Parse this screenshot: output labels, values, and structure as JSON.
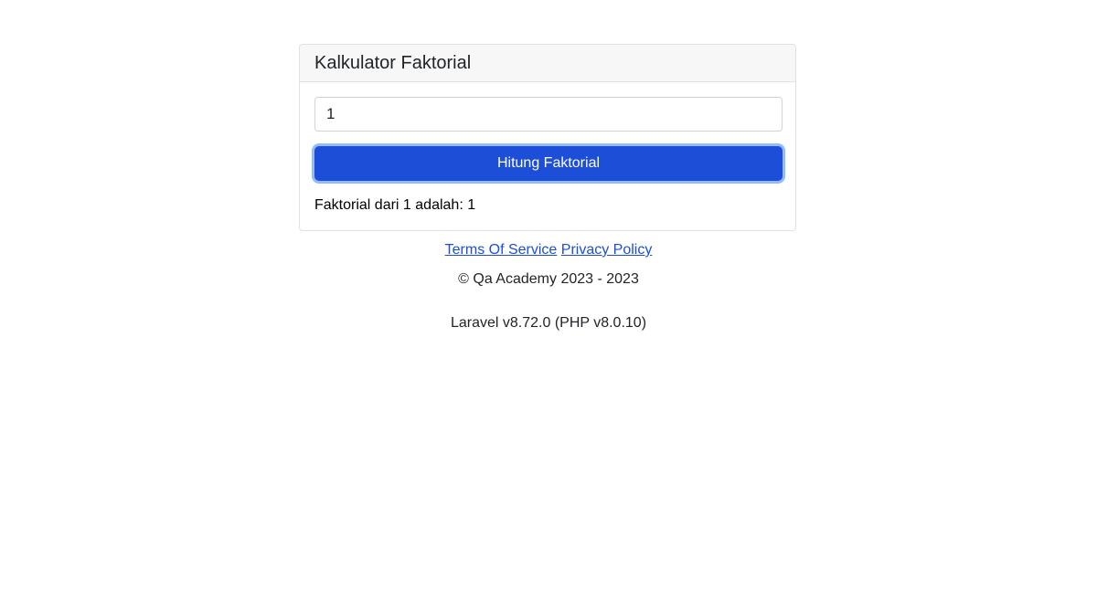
{
  "card": {
    "title": "Kalkulator Faktorial",
    "input_value": "1",
    "button_label": "Hitung Faktorial",
    "result_text": "Faktorial dari 1 adalah: 1"
  },
  "footer": {
    "terms_label": "Terms Of Service",
    "privacy_label": "Privacy Policy",
    "copyright": "© Qa Academy 2023 - 2023",
    "version": "Laravel v8.72.0 (PHP v8.0.10)"
  },
  "colors": {
    "primary": "#1d4ed8",
    "link": "#1d4ed8",
    "header_bg": "#f7f7f7",
    "border": "#dee2e6"
  }
}
